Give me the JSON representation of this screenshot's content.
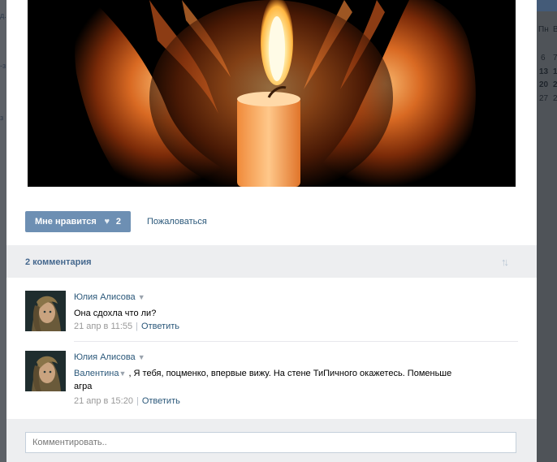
{
  "background_left": {
    "fragments": [
      "д.",
      "-з",
      "з"
    ]
  },
  "calendar": {
    "weekday_labels": [
      "Пн",
      "В"
    ],
    "rows": [
      [
        "6",
        "7"
      ],
      [
        "13",
        "1"
      ],
      [
        "20",
        "2"
      ],
      [
        "27",
        "2"
      ]
    ]
  },
  "post": {
    "photo": {
      "description_icon": "candle-in-hands-photo"
    },
    "like_button": {
      "label": "Мне нравится",
      "count": "2"
    },
    "report_link": "Пожаловаться"
  },
  "comments_header": {
    "count_label": "2 комментария"
  },
  "comments": [
    {
      "author": "Юлия Алисова",
      "text": "Она сдохла что ли?",
      "mention": "",
      "date": "21 апр в 11:55",
      "reply_label": "Ответить"
    },
    {
      "author": "Юлия Алисова",
      "mention": "Валентина",
      "text": ", Я тебя, поцменко, впервые вижу. На стене ТиПичного окажетесь. Поменьше агра",
      "date": "21 апр в 15:20",
      "reply_label": "Ответить"
    }
  ],
  "comment_input": {
    "placeholder": "Комментировать.."
  },
  "colors": {
    "accent": "#6d8fb3",
    "link": "#2b587a",
    "header_bg": "#edeef0"
  }
}
